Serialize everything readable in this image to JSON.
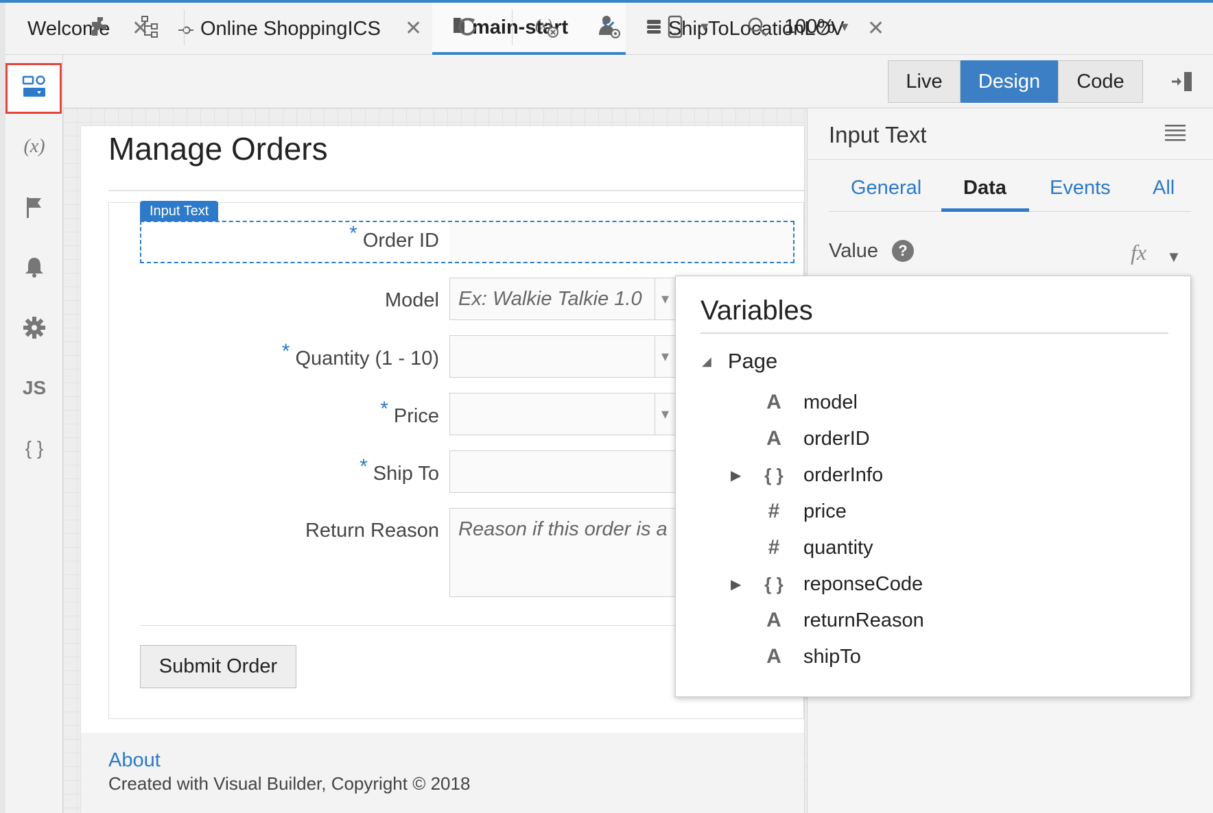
{
  "tabs": [
    {
      "label": "Welcome",
      "icon": ""
    },
    {
      "label": "Online ShoppingICS",
      "icon": "connector-icon"
    },
    {
      "label": "main-start",
      "icon": "file-icon"
    },
    {
      "label": "ShipToLocationLOV",
      "icon": "database-icon"
    }
  ],
  "tab_close": "✕",
  "toolbar": {
    "zoom": "100%",
    "modes": [
      "Live",
      "Design",
      "Code"
    ],
    "active_mode": "Design"
  },
  "left_rail": {
    "icons": [
      "page-designer-icon",
      "variables-icon",
      "flag-icon",
      "bell-icon",
      "gear-icon",
      "js-icon",
      "json-icon"
    ],
    "variables_glyph": "(x)",
    "js_glyph": "JS",
    "json_glyph": "{ }"
  },
  "page": {
    "title": "Manage Orders",
    "selected_component": "Input Text",
    "required_marker": "*",
    "fields": [
      {
        "label": "Order ID",
        "required": true,
        "placeholder": ""
      },
      {
        "label": "Model",
        "required": false,
        "placeholder": "Ex: Walkie Talkie 1.0"
      },
      {
        "label": "Quantity (1 - 10)",
        "required": true,
        "placeholder": ""
      },
      {
        "label": "Price",
        "required": true,
        "placeholder": ""
      },
      {
        "label": "Ship To",
        "required": true,
        "placeholder": ""
      },
      {
        "label": "Return Reason",
        "required": false,
        "placeholder": "Reason if this order is a"
      }
    ],
    "submit_label": "Submit Order",
    "footer": {
      "link": "About",
      "copyright": "Created with Visual Builder, Copyright © 2018"
    }
  },
  "panel": {
    "title": "Input Text",
    "tabs": [
      "General",
      "Data",
      "Events",
      "All"
    ],
    "active_tab": "Data",
    "value_label": "Value",
    "help_glyph": "?",
    "fx_glyph": "fx"
  },
  "variables": {
    "title": "Variables",
    "root": "Page",
    "items": [
      {
        "name": "model",
        "type": "string",
        "glyph": "A",
        "expandable": false
      },
      {
        "name": "orderID",
        "type": "string",
        "glyph": "A",
        "expandable": false
      },
      {
        "name": "orderInfo",
        "type": "object",
        "glyph": "{ }",
        "expandable": true
      },
      {
        "name": "price",
        "type": "number",
        "glyph": "#",
        "expandable": false
      },
      {
        "name": "quantity",
        "type": "number",
        "glyph": "#",
        "expandable": false
      },
      {
        "name": "reponseCode",
        "type": "object",
        "glyph": "{ }",
        "expandable": true
      },
      {
        "name": "returnReason",
        "type": "string",
        "glyph": "A",
        "expandable": false
      },
      {
        "name": "shipTo",
        "type": "string",
        "glyph": "A",
        "expandable": false
      }
    ]
  },
  "colors": {
    "accent": "#3a84c9",
    "active_mode": "#3d7fc4",
    "highlight_border": "#e5443d"
  }
}
